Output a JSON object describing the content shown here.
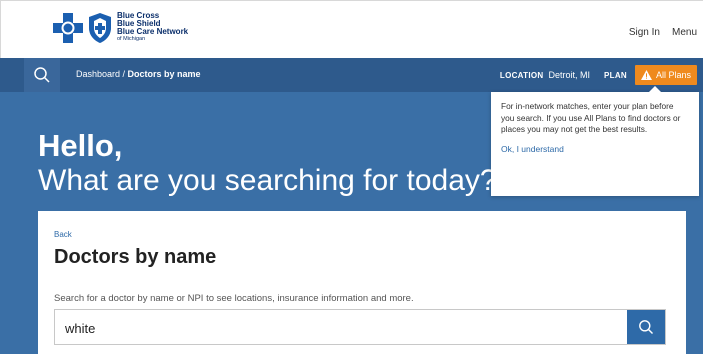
{
  "header": {
    "logo": {
      "line1": "Blue Cross",
      "line2": "Blue Shield",
      "line3": "Blue Care Network",
      "line4": "of Michigan"
    },
    "sign_in": "Sign In",
    "menu": "Menu"
  },
  "nav": {
    "breadcrumb_root": "Dashboard",
    "breadcrumb_sep": " / ",
    "breadcrumb_current": "Doctors by name",
    "location_label": "LOCATION",
    "location_value": "Detroit, MI",
    "plan_label": "PLAN",
    "plan_value": "All Plans"
  },
  "hero": {
    "greeting": "Hello,",
    "question": "What are you searching for today?"
  },
  "tooltip": {
    "message": "For in-network matches, enter your plan before you search. If you use All Plans to find doctors or places you may not get the best results.",
    "action": "Ok, I understand"
  },
  "card": {
    "back": "Back",
    "title": "Doctors by name",
    "help": "Search for a doctor by name or NPI to see locations, insurance information and more.",
    "search_value": "white"
  },
  "colors": {
    "navbar": "#2e5a8c",
    "hero": "#3a6fa6",
    "plan_button": "#ef8a1e",
    "link": "#2e6aa8"
  }
}
